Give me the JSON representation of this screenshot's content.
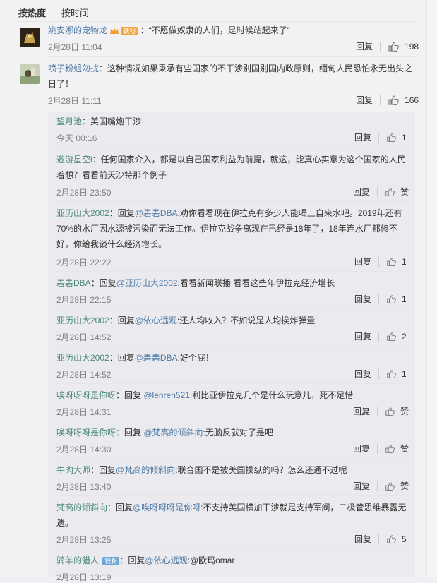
{
  "tabs": {
    "hot": "按热度",
    "time": "按时间"
  },
  "actions": {
    "reply": "回复",
    "like_empty": "赞"
  },
  "comments": [
    {
      "user": "姚安娜的宠物龙",
      "badge": "铁粉",
      "text": "：“不愿做奴隶的人们，是时候站起来了”",
      "time": "2月28日 11:04",
      "likes": "198"
    },
    {
      "user": "喷子粉蛆勿扰",
      "text_line1": "：这种情况如果秉承有些国家的不干涉别国别国内政原则，缅甸人民恐怕永无出头之",
      "text_line2": "日了！",
      "time": "2月28日 11:11",
      "likes": "166"
    }
  ],
  "replies": [
    {
      "user": "望月池",
      "text": "：美国嘴炮干涉",
      "time": "今天 00:16",
      "likes": "1"
    },
    {
      "user": "邀游星空l",
      "line1": "：任何国家介入，都是以自己国家利益为前提，就这，能真心实意为这个国家的人民",
      "line2": "着想？看看前天沙特那个例子",
      "time": "2月28日 23:50",
      "likes": ""
    },
    {
      "user": "亚历山大2002",
      "prefix": "：回复",
      "mention": "@砉砉DBA",
      "line1": ":劝你看看现在伊拉克有多少人能喝上自来水吧。2019年还有",
      "line2": "70%的水厂因水源被污染而无法工作。伊拉克战争离现在已经是18年了，18年连水厂都修不",
      "line3": "好，你给我谈什么经济增长。",
      "time": "2月28日 22:22",
      "likes": "1"
    },
    {
      "user": "砉砉DBA",
      "prefix": "：回复",
      "mention": "@亚历山大2002",
      "line1": ":看看新闻联播 看看这些年伊拉克经济增长",
      "time": "2月28日 22:15",
      "likes": "1"
    },
    {
      "user": "亚历山大2002",
      "prefix": "：回复",
      "mention": "@依心远观",
      "line1": ":还人均收入？不如说是人均挨炸弹量",
      "time": "2月28日 14:52",
      "likes": "2"
    },
    {
      "user": "亚历山大2002",
      "prefix": "：回复",
      "mention": "@砉砉DBA",
      "line1": ":好个屁！",
      "time": "2月28日 14:52",
      "likes": "1"
    },
    {
      "user": "唉呀呀呀是你呀",
      "prefix": "：回复 ",
      "mention": "@lenren521",
      "line1": ":利比亚伊拉克几个是什么玩意儿，死不足惜",
      "time": "2月28日 14:31",
      "likes": ""
    },
    {
      "user": "唉呀呀呀是你呀",
      "prefix": "：回复 ",
      "mention": "@梵高的倾斜向",
      "line1": ":无脑反就对了是吧",
      "time": "2月28日 14:30",
      "likes": ""
    },
    {
      "user": "牛肉大师",
      "prefix": "：回复",
      "mention": "@梵高的倾斜向",
      "line1": ":联合国不是被美国操纵的吗？怎么还通不过呢",
      "time": "2月28日 13:40",
      "likes": ""
    },
    {
      "user": "梵高的倾斜向",
      "prefix": "：回复",
      "mention": "@唉呀呀呀是你呀",
      "line1": ":不支持美国横加干涉就是支持军阀，二极管思维暴露无",
      "line2": "遗。",
      "time": "2月28日 13:25",
      "likes": "5"
    },
    {
      "user": "骑羊的猎人",
      "badge": "铁粉",
      "prefix": "：回复",
      "mention": "@依心远观",
      "line1": ":@欧玛omar",
      "time": "2月28日 13:19",
      "likes": ""
    }
  ]
}
